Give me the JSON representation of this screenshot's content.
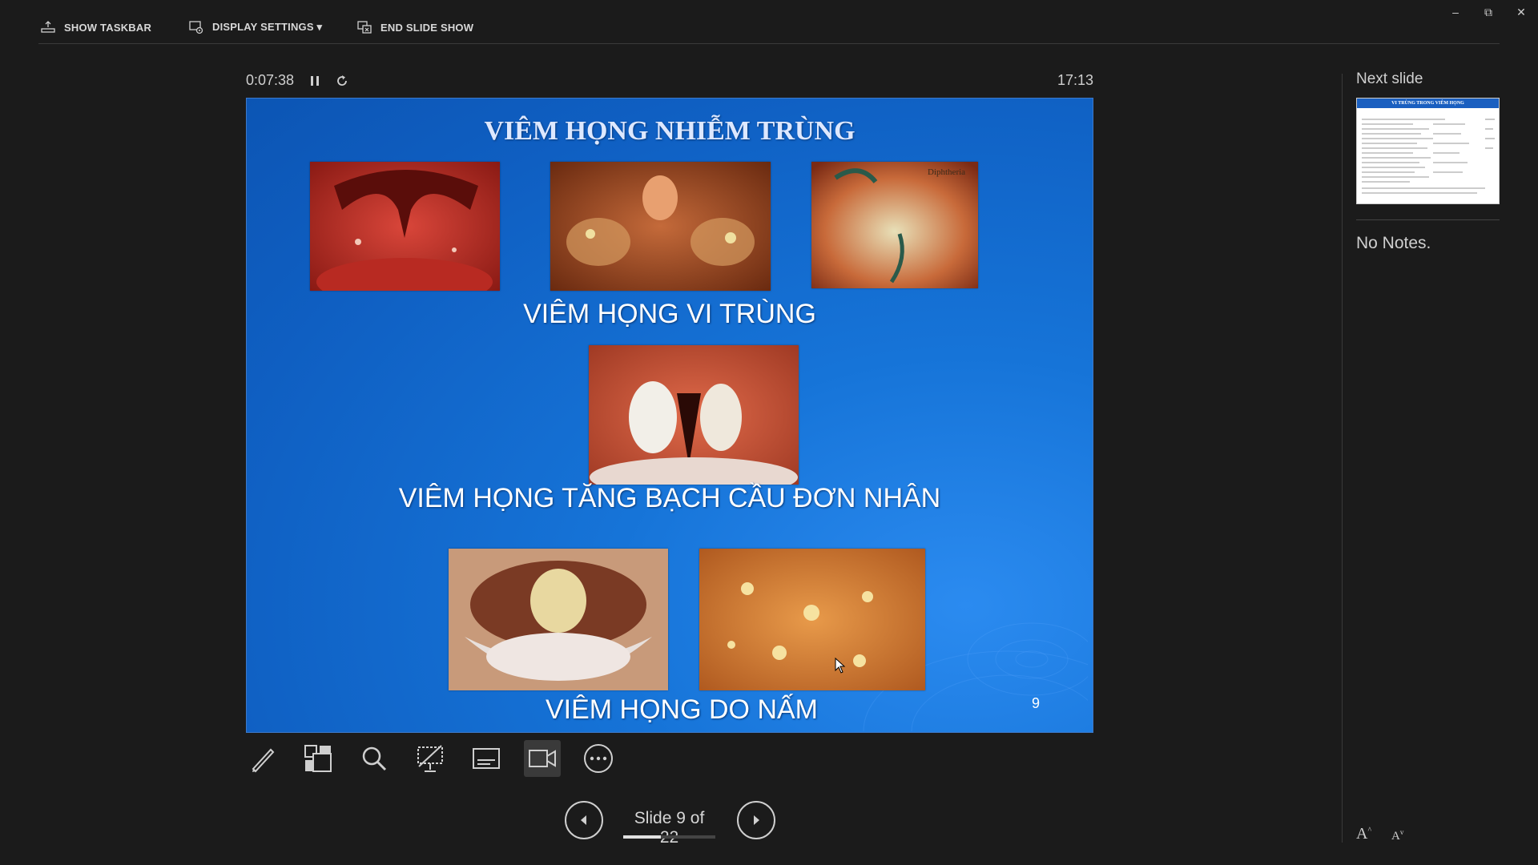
{
  "toolbar": {
    "show_taskbar": "SHOW TASKBAR",
    "display_settings": "DISPLAY SETTINGS ▾",
    "end_slide_show": "END SLIDE SHOW"
  },
  "timer": {
    "elapsed": "0:07:38",
    "clock": "17:13"
  },
  "slide": {
    "title": "VIÊM HỌNG NHIỄM TRÙNG",
    "caption1": "VIÊM HỌNG VI TRÙNG",
    "caption2": "VIÊM HỌNG TĂNG BẠCH CẦU ĐƠN NHÂN",
    "caption3": "VIÊM HỌNG DO NẤM",
    "photo_label": "Diphtheria",
    "number": "9"
  },
  "navigation": {
    "counter": "Slide 9 of 22",
    "progress": 0.409
  },
  "right_pane": {
    "next_label": "Next slide",
    "next_thumb_title": "VI TRÙNG TRONG VIÊM HỌNG",
    "notes": "No Notes."
  },
  "colors": {
    "background": "#1b1b1b",
    "slide_blue": "#1674d8",
    "accent": "#e0e0e0"
  }
}
